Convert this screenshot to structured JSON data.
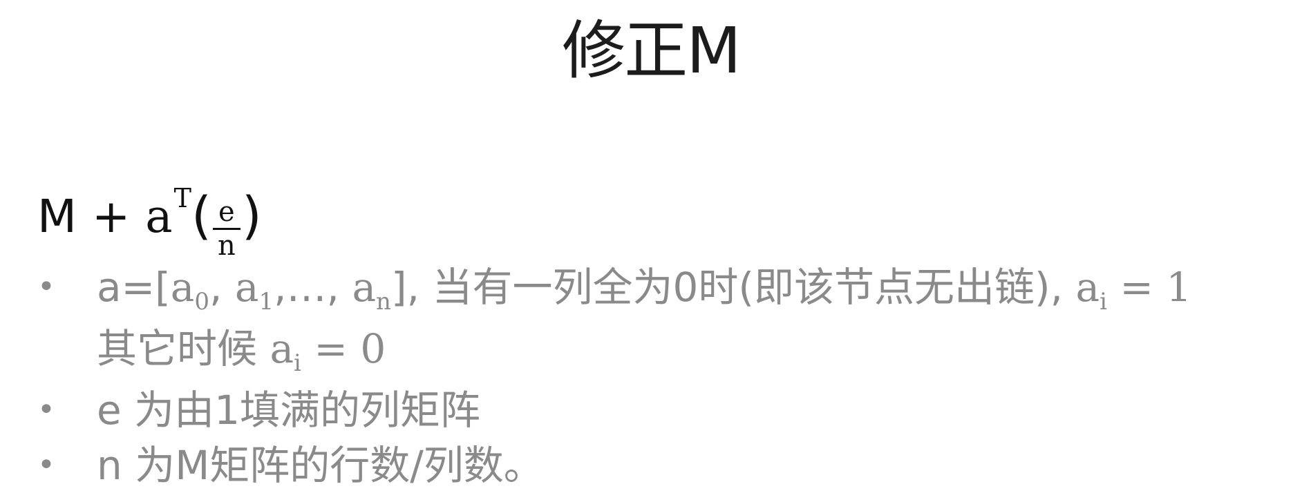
{
  "slide": {
    "title": "修正M"
  },
  "formula": {
    "m": "M",
    "plus": "+",
    "a": "a",
    "transpose": "T",
    "open_paren": "(",
    "numerator": "e",
    "denominator": "n",
    "close_paren": ")"
  },
  "bullets": [
    {
      "dot": "•",
      "text_a": "a=[",
      "a0_base": "a",
      "a0_sub": "0",
      "sep1": ", ",
      "a1_base": "a",
      "a1_sub": "1",
      "sep2": ",…, ",
      "an_base": "a",
      "an_sub": "n",
      "text_b": "], 当有一列全为0时(即该节点无出链), ",
      "ai_base": "a",
      "ai_sub": "i",
      "text_c": " = 1",
      "line2_text": "其它时候 ",
      "ai2_base": "a",
      "ai2_sub": "i",
      "line2_end": " = 0"
    },
    {
      "dot": "•",
      "text": "e 为由1填满的列矩阵"
    },
    {
      "dot": "•",
      "text": "n 为M矩阵的行数/列数。"
    }
  ],
  "colors": {
    "title": "#1c1c1c",
    "formula": "#111111",
    "bullet_text": "#8a8a8a",
    "background": "#ffffff"
  }
}
